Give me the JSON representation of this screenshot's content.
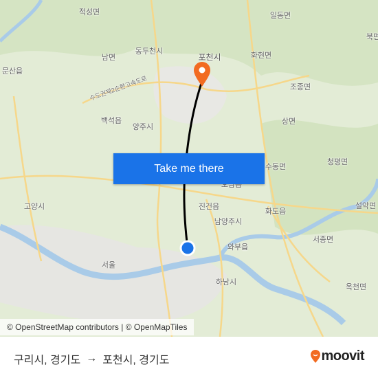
{
  "map": {
    "places": [
      {
        "name": "적성면"
      },
      {
        "name": "일동면"
      },
      {
        "name": "북면"
      },
      {
        "name": "남면"
      },
      {
        "name": "동두천시"
      },
      {
        "name": "포천시"
      },
      {
        "name": "화현면"
      },
      {
        "name": "문산읍"
      },
      {
        "name": "조종면"
      },
      {
        "name": "백석읍"
      },
      {
        "name": "양주시"
      },
      {
        "name": "상면"
      },
      {
        "name": "청평면"
      },
      {
        "name": "수동면"
      },
      {
        "name": "오남읍"
      },
      {
        "name": "진건읍"
      },
      {
        "name": "고양시"
      },
      {
        "name": "화도읍"
      },
      {
        "name": "설악면"
      },
      {
        "name": "남양주시"
      },
      {
        "name": "와부읍"
      },
      {
        "name": "서종면"
      },
      {
        "name": "서울"
      },
      {
        "name": "하남시"
      },
      {
        "name": "옥천면"
      }
    ],
    "road_label": "수도권제2순환고속도로",
    "route_color": "#000000",
    "origin_color": "#1a73e8",
    "destination_color": "#f26b21",
    "cta_label": "Take me there",
    "attribution": "© OpenStreetMap contributors | © OpenMapTiles"
  },
  "footer": {
    "from": "구리시, 경기도",
    "arrow": "→",
    "to": "포천시, 경기도",
    "logo_text": "moovit",
    "logo_color": "#f26b21"
  }
}
